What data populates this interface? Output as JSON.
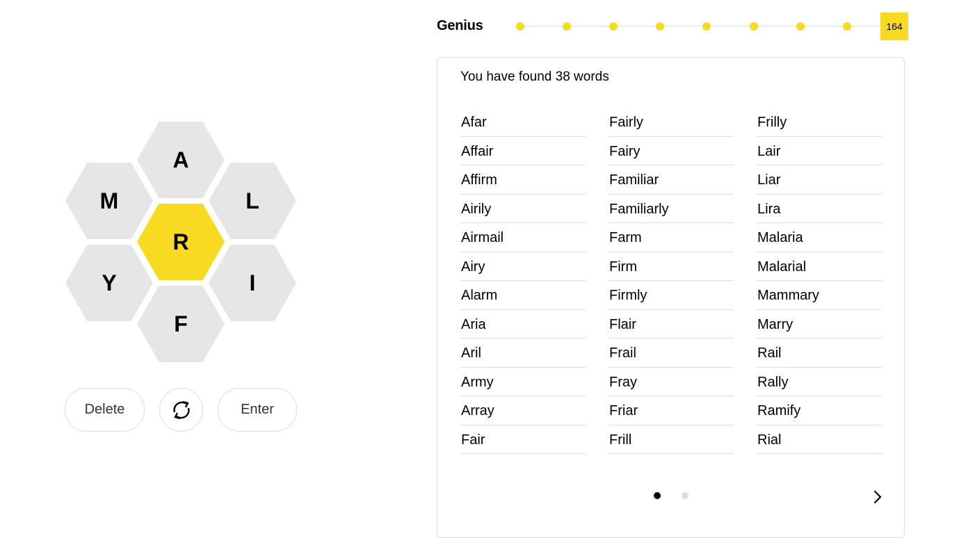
{
  "hive": {
    "center_letter": "R",
    "outer_letters": {
      "top": "A",
      "upper_left": "M",
      "upper_right": "L",
      "lower_left": "Y",
      "lower_right": "I",
      "bottom": "F"
    }
  },
  "actions": {
    "delete_label": "Delete",
    "shuffle_icon": "shuffle-icon",
    "enter_label": "Enter"
  },
  "progress": {
    "rank": "Genius",
    "score": "164",
    "dots": 8
  },
  "wordlist": {
    "found_text": "You have found 38 words",
    "columns": [
      [
        "Afar",
        "Affair",
        "Affirm",
        "Airily",
        "Airmail",
        "Airy",
        "Alarm",
        "Aria",
        "Aril",
        "Army",
        "Array",
        "Fair"
      ],
      [
        "Fairly",
        "Fairy",
        "Familiar",
        "Familiarly",
        "Farm",
        "Firm",
        "Firmly",
        "Flair",
        "Frail",
        "Fray",
        "Friar",
        "Frill"
      ],
      [
        "Frilly",
        "Lair",
        "Liar",
        "Lira",
        "Malaria",
        "Malarial",
        "Mammary",
        "Marry",
        "Rail",
        "Rally",
        "Ramify",
        "Rial"
      ]
    ],
    "pagination": {
      "current_page": 1,
      "total_pages": 2
    },
    "next_icon": "chevron-right-icon"
  },
  "colors": {
    "accent_yellow": "#f7da21",
    "cell_gray": "#e6e6e6",
    "border_gray": "#dcdcdc"
  }
}
